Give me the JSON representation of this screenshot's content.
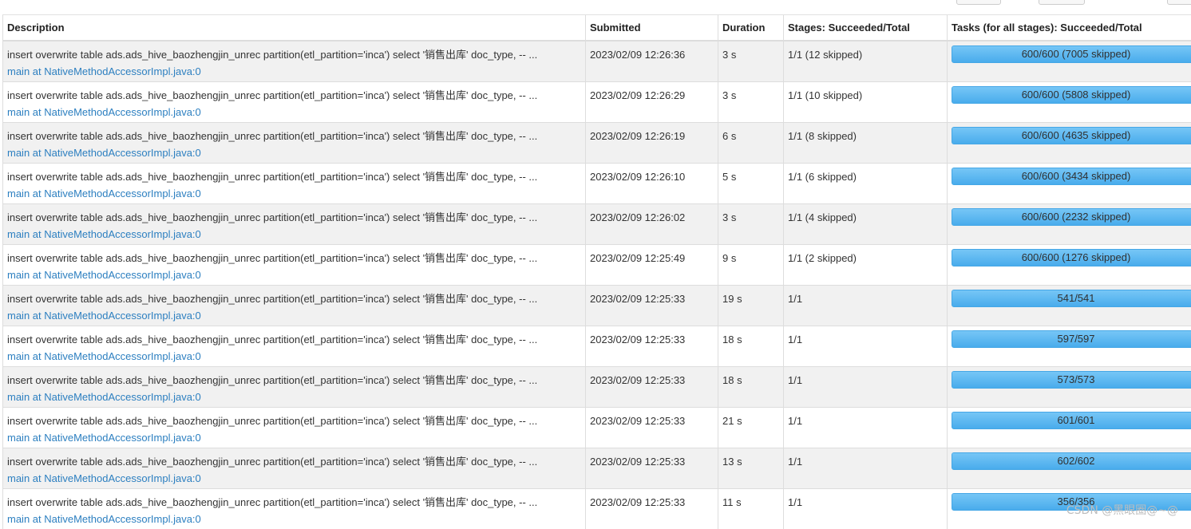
{
  "headers": {
    "description": "Description",
    "submitted": "Submitted",
    "duration": "Duration",
    "stages": "Stages: Succeeded/Total",
    "tasks": "Tasks (for all stages): Succeeded/Total"
  },
  "rows": [
    {
      "description": "insert overwrite table ads.ads_hive_baozhengjin_unrec partition(etl_partition='inca') select '销售出库' doc_type, -- ...",
      "callsite": "main at NativeMethodAccessorImpl.java:0",
      "submitted": "2023/02/09 12:26:36",
      "duration": "3 s",
      "stages": "1/1 (12 skipped)",
      "tasks": "600/600 (7005 skipped)",
      "progress": 1.0
    },
    {
      "description": "insert overwrite table ads.ads_hive_baozhengjin_unrec partition(etl_partition='inca') select '销售出库' doc_type, -- ...",
      "callsite": "main at NativeMethodAccessorImpl.java:0",
      "submitted": "2023/02/09 12:26:29",
      "duration": "3 s",
      "stages": "1/1 (10 skipped)",
      "tasks": "600/600 (5808 skipped)",
      "progress": 1.0
    },
    {
      "description": "insert overwrite table ads.ads_hive_baozhengjin_unrec partition(etl_partition='inca') select '销售出库' doc_type, -- ...",
      "callsite": "main at NativeMethodAccessorImpl.java:0",
      "submitted": "2023/02/09 12:26:19",
      "duration": "6 s",
      "stages": "1/1 (8 skipped)",
      "tasks": "600/600 (4635 skipped)",
      "progress": 1.0
    },
    {
      "description": "insert overwrite table ads.ads_hive_baozhengjin_unrec partition(etl_partition='inca') select '销售出库' doc_type, -- ...",
      "callsite": "main at NativeMethodAccessorImpl.java:0",
      "submitted": "2023/02/09 12:26:10",
      "duration": "5 s",
      "stages": "1/1 (6 skipped)",
      "tasks": "600/600 (3434 skipped)",
      "progress": 1.0
    },
    {
      "description": "insert overwrite table ads.ads_hive_baozhengjin_unrec partition(etl_partition='inca') select '销售出库' doc_type, -- ...",
      "callsite": "main at NativeMethodAccessorImpl.java:0",
      "submitted": "2023/02/09 12:26:02",
      "duration": "3 s",
      "stages": "1/1 (4 skipped)",
      "tasks": "600/600 (2232 skipped)",
      "progress": 1.0
    },
    {
      "description": "insert overwrite table ads.ads_hive_baozhengjin_unrec partition(etl_partition='inca') select '销售出库' doc_type, -- ...",
      "callsite": "main at NativeMethodAccessorImpl.java:0",
      "submitted": "2023/02/09 12:25:49",
      "duration": "9 s",
      "stages": "1/1 (2 skipped)",
      "tasks": "600/600 (1276 skipped)",
      "progress": 1.0
    },
    {
      "description": "insert overwrite table ads.ads_hive_baozhengjin_unrec partition(etl_partition='inca') select '销售出库' doc_type, -- ...",
      "callsite": "main at NativeMethodAccessorImpl.java:0",
      "submitted": "2023/02/09 12:25:33",
      "duration": "19 s",
      "stages": "1/1",
      "tasks": "541/541",
      "progress": 1.0
    },
    {
      "description": "insert overwrite table ads.ads_hive_baozhengjin_unrec partition(etl_partition='inca') select '销售出库' doc_type, -- ...",
      "callsite": "main at NativeMethodAccessorImpl.java:0",
      "submitted": "2023/02/09 12:25:33",
      "duration": "18 s",
      "stages": "1/1",
      "tasks": "597/597",
      "progress": 1.0
    },
    {
      "description": "insert overwrite table ads.ads_hive_baozhengjin_unrec partition(etl_partition='inca') select '销售出库' doc_type, -- ...",
      "callsite": "main at NativeMethodAccessorImpl.java:0",
      "submitted": "2023/02/09 12:25:33",
      "duration": "18 s",
      "stages": "1/1",
      "tasks": "573/573",
      "progress": 1.0
    },
    {
      "description": "insert overwrite table ads.ads_hive_baozhengjin_unrec partition(etl_partition='inca') select '销售出库' doc_type, -- ...",
      "callsite": "main at NativeMethodAccessorImpl.java:0",
      "submitted": "2023/02/09 12:25:33",
      "duration": "21 s",
      "stages": "1/1",
      "tasks": "601/601",
      "progress": 1.0
    },
    {
      "description": "insert overwrite table ads.ads_hive_baozhengjin_unrec partition(etl_partition='inca') select '销售出库' doc_type, -- ...",
      "callsite": "main at NativeMethodAccessorImpl.java:0",
      "submitted": "2023/02/09 12:25:33",
      "duration": "13 s",
      "stages": "1/1",
      "tasks": "602/602",
      "progress": 1.0
    },
    {
      "description": "insert overwrite table ads.ads_hive_baozhengjin_unrec partition(etl_partition='inca') select '销售出库' doc_type, -- ...",
      "callsite": "main at NativeMethodAccessorImpl.java:0",
      "submitted": "2023/02/09 12:25:33",
      "duration": "11 s",
      "stages": "1/1",
      "tasks": "356/356",
      "progress": 1.0
    }
  ],
  "watermark": "CSDN @黑眼圈@~@",
  "colors": {
    "progress_bar": "#4fb1ef",
    "link": "#2c7fc0",
    "odd_row": "#f1f1f1"
  }
}
